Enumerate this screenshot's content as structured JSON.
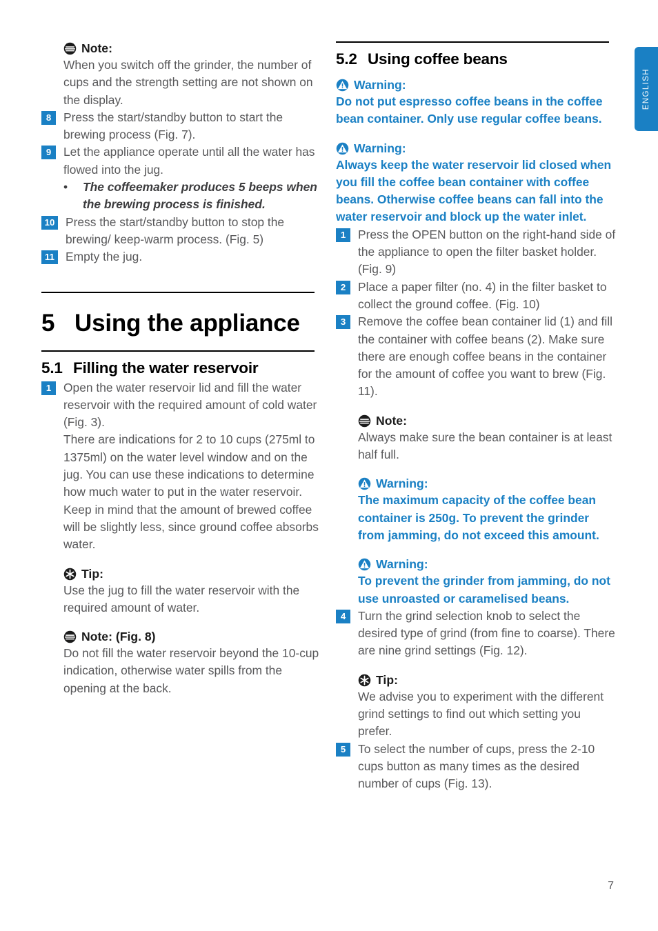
{
  "page": {
    "language_tab": "ENGLISH",
    "page_number": "7",
    "accent_color": "#1a80c4",
    "text_color": "#58585a",
    "heading_color": "#000000"
  },
  "icons": {
    "note": "note-icon",
    "tip": "tip-icon",
    "warning": "warning-icon"
  },
  "left_column": {
    "note_top": {
      "label": "Note:",
      "text": "When you switch off the grinder, the number of cups and the strength setting are not shown on the display."
    },
    "steps": [
      {
        "num": "8",
        "text": "Press the start/standby button to start the brewing process (Fig. 7)."
      },
      {
        "num": "9",
        "text": "Let the appliance operate until all the water has flowed into the jug."
      }
    ],
    "bullet": {
      "marker": "•",
      "text": "The coffeemaker produces 5 beeps when the brewing process is finished."
    },
    "steps_after": [
      {
        "num": "10",
        "text": "Press the start/standby button to stop the brewing/ keep-warm process.  (Fig. 5)"
      },
      {
        "num": "11",
        "text": "Empty the jug."
      }
    ],
    "chapter": {
      "number": "5",
      "title": "Using the appliance"
    },
    "section": {
      "number": "5.1",
      "title": "Filling the water reservoir"
    },
    "section_steps": [
      {
        "num": "1",
        "text": "Open the water reservoir lid and fill the water reservoir with the required amount of cold water (Fig. 3)."
      }
    ],
    "section_paragraph": "There are indications for 2 to 10 cups (275ml to 1375ml) on the water level window and on the jug. You can use these indications to determine how much water to put in the water reservoir. Keep in mind that the amount of brewed coffee will be slightly less, since ground coffee absorbs water.",
    "tip": {
      "label": "Tip:",
      "text": "Use the jug to fill the water reservoir with the required amount of water."
    },
    "note_bottom": {
      "label": "Note: (Fig. 8)",
      "text": "Do not fill the water reservoir beyond the 10-cup indication, otherwise water spills from the opening at the back."
    }
  },
  "right_column": {
    "section": {
      "number": "5.2",
      "title": "Using coffee beans"
    },
    "warning_1": {
      "label": "Warning:",
      "text": "Do not put espresso coffee beans in the coffee bean container. Only use regular coffee beans."
    },
    "warning_2": {
      "label": "Warning:",
      "text": "Always keep the water reservoir lid closed when you fill the coffee bean container with coffee beans. Otherwise coffee beans can fall into the water reservoir and block up the water inlet."
    },
    "steps_1": [
      {
        "num": "1",
        "text": "Press the OPEN button on the right-hand side of the appliance to open the filter basket holder.  (Fig. 9)"
      },
      {
        "num": "2",
        "text": "Place a paper filter (no. 4) in the filter basket to collect the ground coffee.  (Fig. 10)"
      },
      {
        "num": "3",
        "text": "Remove the coffee bean container lid (1) and fill the container with coffee beans (2). Make sure there are enough coffee beans in the container for the amount of coffee you want to brew (Fig. 11)."
      }
    ],
    "note": {
      "label": "Note:",
      "text": "Always make sure the bean container is at least half full."
    },
    "warning_3": {
      "label": "Warning:",
      "text": "The maximum capacity of the coffee bean container is 250g. To prevent the grinder from jamming, do not exceed this amount."
    },
    "warning_4": {
      "label": "Warning:",
      "text": "To prevent the grinder from jamming, do not use unroasted or caramelised beans."
    },
    "steps_2": [
      {
        "num": "4",
        "text": "Turn the grind selection knob to select the desired type of grind (from fine to coarse). There are nine grind settings (Fig. 12)."
      }
    ],
    "tip": {
      "label": "Tip:",
      "text": "We advise you to experiment with the different grind settings to find out which setting you prefer."
    },
    "steps_3": [
      {
        "num": "5",
        "text": "To select the number of cups, press the 2-10 cups button as many times as the desired number of cups (Fig. 13)."
      }
    ]
  }
}
